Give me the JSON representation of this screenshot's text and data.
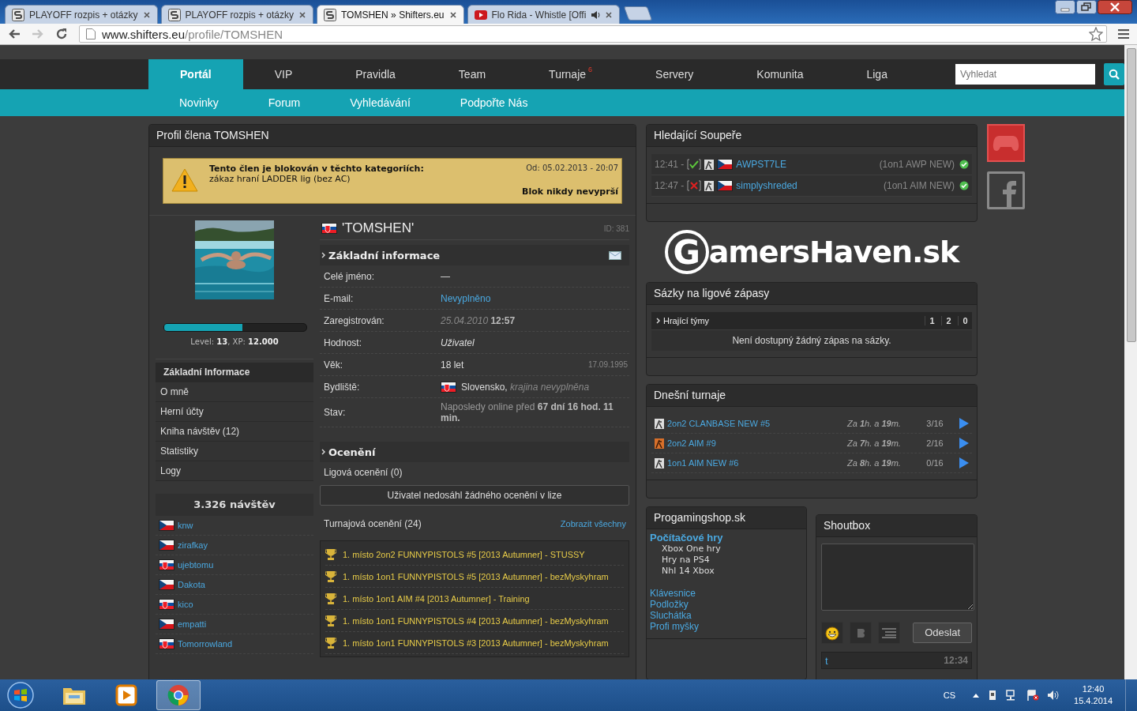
{
  "browser": {
    "tabs": [
      {
        "title": "PLAYOFF rozpis + otázky",
        "kind": "site",
        "selected": false,
        "audio": false
      },
      {
        "title": "PLAYOFF rozpis + otázky",
        "kind": "site",
        "selected": false,
        "audio": false
      },
      {
        "title": "TOMSHEN » Shifters.eu",
        "kind": "site",
        "selected": true,
        "audio": false
      },
      {
        "title": "Flo Rida - Whistle [Offi",
        "kind": "video",
        "selected": false,
        "audio": true
      }
    ],
    "forward_disabled": true,
    "address": {
      "host": "www.shifters.eu",
      "path": "/profile/TOMSHEN"
    }
  },
  "nav": {
    "main": [
      {
        "label": "Portál",
        "selected": true
      },
      {
        "label": "VIP",
        "selected": false
      },
      {
        "label": "Pravidla",
        "selected": false
      },
      {
        "label": "Team",
        "selected": false
      },
      {
        "label": "Turnaje",
        "selected": false,
        "badge": "6"
      },
      {
        "label": "Servery",
        "selected": false
      },
      {
        "label": "Komunita",
        "selected": false
      },
      {
        "label": "Liga",
        "selected": false
      }
    ],
    "search": {
      "placeholder": "Vyhledat"
    },
    "sub": [
      "Novinky",
      "Forum",
      "Vyhledávání",
      "Podpořte Nás"
    ]
  },
  "profile": {
    "title": "Profil člena TOMSHEN",
    "block": {
      "heading": "Tento člen je blokován v těchto kategoriích:",
      "text": "zákaz hraní LADDER lig (bez AC)",
      "since": "Od: 05.02.2013 - 20:07",
      "expiry": "Blok nikdy nevyprší"
    },
    "level": 0.55,
    "level_text": "Level: **13**, XP: **12.000**",
    "menu": [
      {
        "label": "Základní Informace",
        "selected": true
      },
      {
        "label": "O mně",
        "selected": false
      },
      {
        "label": "Herní účty",
        "selected": false
      },
      {
        "label": "Kniha návštěv (12)",
        "selected": false
      },
      {
        "label": "Statistiky",
        "selected": false
      },
      {
        "label": "Logy",
        "selected": false
      }
    ],
    "visits": "3.326 návštěv",
    "visitors": [
      {
        "name": "knw",
        "kind": "cz"
      },
      {
        "name": "zirafkay",
        "kind": "cz"
      },
      {
        "name": "ujebtomu",
        "kind": "sk"
      },
      {
        "name": "Dakota",
        "kind": "cz"
      },
      {
        "name": "kico",
        "kind": "sk"
      },
      {
        "name": "empatti",
        "kind": "cz"
      },
      {
        "name": "Tomorrowland",
        "kind": "sk"
      }
    ],
    "name": "'TOMSHEN'",
    "id": "ID: 381",
    "info_heading": "Základní informace",
    "info": [
      {
        "label": "Celé jméno:",
        "value": "—",
        "kind": "text"
      },
      {
        "label": "E-mail:",
        "value": "Nevyplněno",
        "kind": "link"
      },
      {
        "label": "Zaregistrován:",
        "value": "*25.04.2010* **12:57**",
        "kind": "muted"
      },
      {
        "label": "Hodnost:",
        "value": "Uživatel",
        "kind": "italic"
      },
      {
        "label": "Věk:",
        "value": "18 let",
        "kind": "text",
        "note": "17.09.1995"
      },
      {
        "label": "Bydliště:",
        "value": "Slovensko, *krajina nevyplněna*",
        "kind": "place"
      },
      {
        "label": "Stav:",
        "value": "Naposledy online před **67 dní 16 hod. 11 min.**",
        "kind": "muted"
      }
    ],
    "awards_heading": "Ocenění",
    "league_awards": "Ligová ocenění (0)",
    "league_empty": "Uživatel nedosáhl žádného ocenění v lize",
    "tournament_awards": "Turnajová ocenění (24)",
    "show_all": "Zobrazit všechny",
    "awards": [
      "1. místo 2on2 FUNNYPISTOLS #5 [2013 Autumner] - STUSSY",
      "1. místo 1on1 FUNNYPISTOLS #5 [2013 Autumner] - bezMyskyhram",
      "1. místo 1on1 AIM #4 [2013 Autumner] - Training",
      "1. místo 1on1 FUNNYPISTOLS #4 [2013 Autumner] - bezMyskyhram",
      "1. místo 1on1 FUNNYPISTOLS #3 [2013 Autumner] - bezMyskyhram"
    ]
  },
  "opponents": {
    "title": "Hledající Soupeře",
    "rows": [
      {
        "time": "12:41 -",
        "kind": "ok",
        "name": "AWPST7LE",
        "mode": "(1on1 AWP NEW)",
        "online": true
      },
      {
        "time": "12:47 -",
        "kind": "fail",
        "name": "simplyshreded",
        "mode": "(1on1 AIM NEW)",
        "online": true
      }
    ]
  },
  "logo": {
    "initial": "G",
    "text": "amersHaven.sk"
  },
  "bets": {
    "title": "Sázky na ligové zápasy",
    "heading": "Hrající týmy",
    "columns": [
      "1",
      "2",
      "0"
    ],
    "empty": "Není dostupný žádný zápas na sázky."
  },
  "tournaments": {
    "title": "Dnešní turnaje",
    "rows": [
      {
        "kind": "grey",
        "name": "2on2 CLANBASE NEW #5",
        "starts": "Za **1**h. a **19**m.",
        "slots": "3/16"
      },
      {
        "kind": "orange",
        "name": "2on2 AIM #9",
        "starts": "Za **7**h. a **19**m.",
        "slots": "2/16"
      },
      {
        "kind": "grey",
        "name": "1on1 AIM NEW #6",
        "starts": "Za **8**h. a **19**m.",
        "slots": "0/16"
      }
    ]
  },
  "shop": {
    "title": "Progamingshop.sk",
    "category": "Počítačové hry",
    "subitems": [
      "Xbox One hry",
      "Hry na PS4",
      "Nhl 14 Xbox"
    ],
    "links": [
      "Klávesnice",
      "Podložky",
      "Sluchátka",
      "Profi myšky"
    ]
  },
  "shoutbox": {
    "title": "Shoutbox",
    "send": "Odeslat",
    "message": {
      "author": "t",
      "time": "12:34"
    }
  },
  "taskbar": {
    "apps": [
      {
        "kind": "explorer",
        "selected": false
      },
      {
        "kind": "media",
        "selected": false
      },
      {
        "kind": "chrome",
        "selected": true
      }
    ],
    "language": "CS",
    "time": "12:40",
    "date": "15.4.2014"
  }
}
